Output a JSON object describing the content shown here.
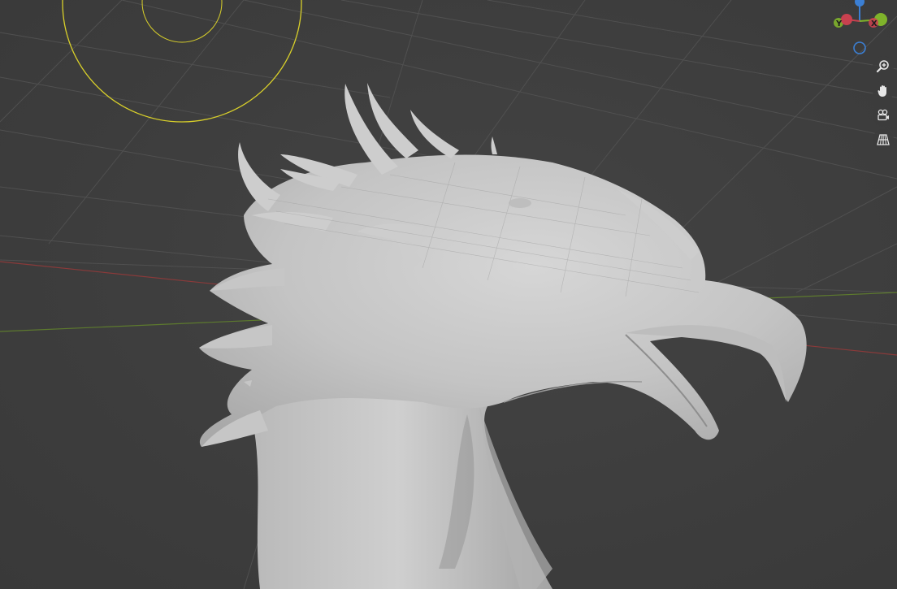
{
  "viewport": {
    "background": "#3d3d3d",
    "grid_color": "#4f4f4f",
    "axis_x_color": "#8a3a3a",
    "axis_y_color": "#5d7a2e",
    "brush_color": "#d9d02a",
    "model_color": "#c8c8c8"
  },
  "gizmo": {
    "x_label": "X",
    "y_label": "Y",
    "x_color": "#c8414f",
    "y_color": "#7fb32b",
    "z_color": "#3b7fd4"
  },
  "nav_buttons": [
    {
      "name": "zoom",
      "icon": "zoom-icon"
    },
    {
      "name": "pan",
      "icon": "hand-icon"
    },
    {
      "name": "camera",
      "icon": "camera-icon"
    },
    {
      "name": "ortho",
      "icon": "grid-icon"
    }
  ]
}
